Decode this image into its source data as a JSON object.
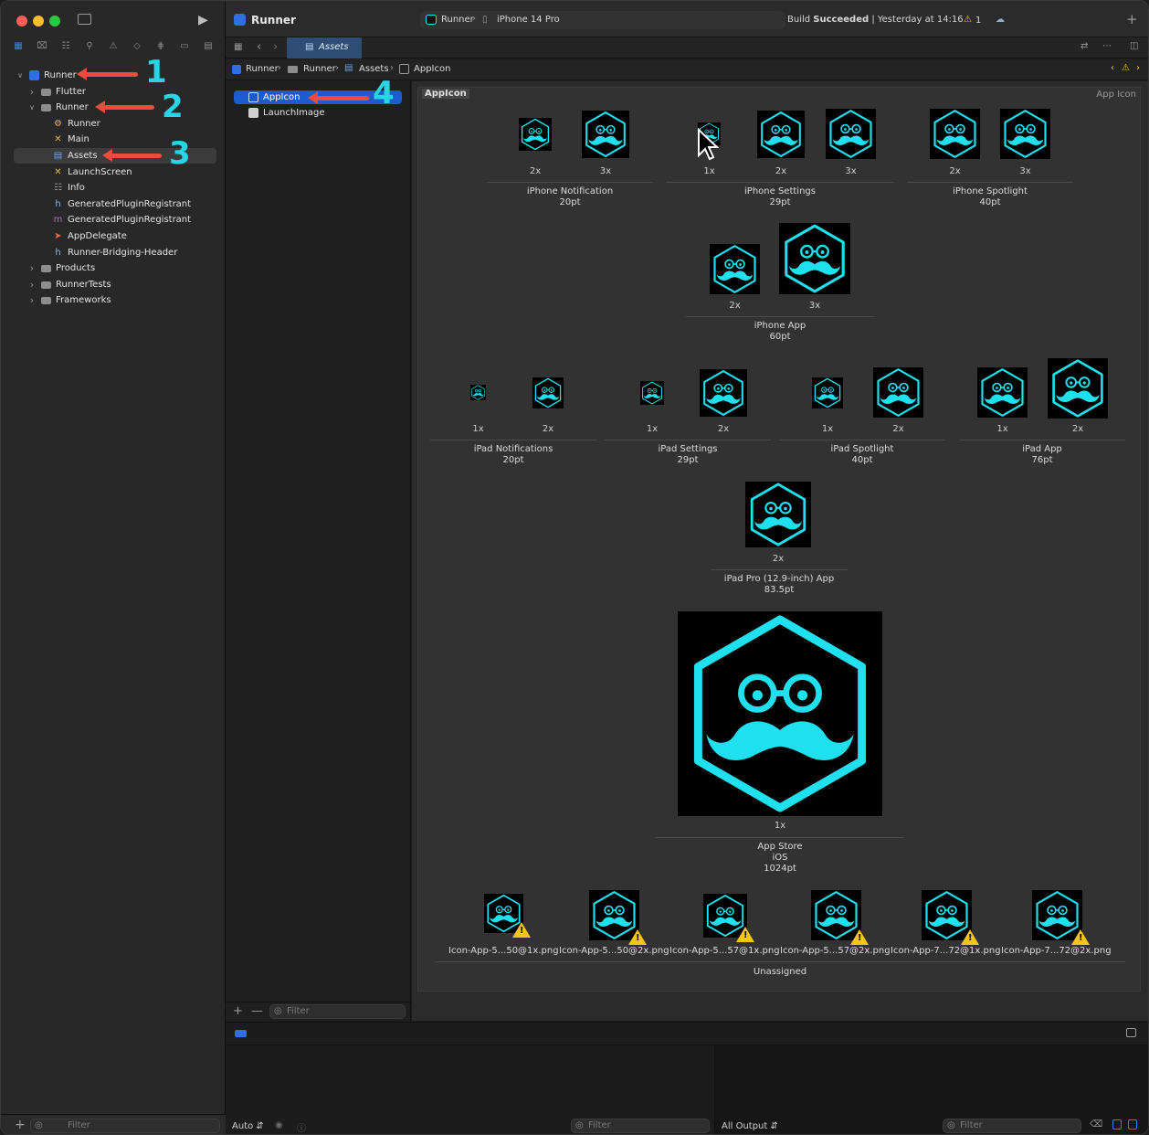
{
  "window": {
    "title": "Runner",
    "scheme": "Runner",
    "device": "iPhone 14 Pro",
    "status_prefix": "Build",
    "status_main": "Succeeded",
    "status_time": "Yesterday at 14:16",
    "warning_count": "1"
  },
  "tabs": [
    {
      "label": "Assets"
    }
  ],
  "breadcrumb": [
    "Runner",
    "Runner",
    "Assets",
    "AppIcon"
  ],
  "navigator": {
    "items": [
      {
        "label": "Runner",
        "level": 0,
        "kind": "project",
        "expanded": true
      },
      {
        "label": "Flutter",
        "level": 1,
        "kind": "folder",
        "expanded": false
      },
      {
        "label": "Runner",
        "level": 1,
        "kind": "folder",
        "expanded": true
      },
      {
        "label": "Runner",
        "level": 2,
        "kind": "entitlements"
      },
      {
        "label": "Main",
        "level": 2,
        "kind": "storyboard"
      },
      {
        "label": "Assets",
        "level": 2,
        "kind": "assets",
        "selected": true
      },
      {
        "label": "LaunchScreen",
        "level": 2,
        "kind": "storyboard"
      },
      {
        "label": "Info",
        "level": 2,
        "kind": "plist"
      },
      {
        "label": "GeneratedPluginRegistrant",
        "level": 2,
        "kind": "header"
      },
      {
        "label": "GeneratedPluginRegistrant",
        "level": 2,
        "kind": "objc"
      },
      {
        "label": "AppDelegate",
        "level": 2,
        "kind": "swift"
      },
      {
        "label": "Runner-Bridging-Header",
        "level": 2,
        "kind": "header"
      },
      {
        "label": "Products",
        "level": 1,
        "kind": "folder",
        "expanded": false
      },
      {
        "label": "RunnerTests",
        "level": 1,
        "kind": "folder",
        "expanded": false
      },
      {
        "label": "Frameworks",
        "level": 1,
        "kind": "folder",
        "expanded": false
      }
    ],
    "filter_placeholder": "Filter"
  },
  "annotations": [
    "1",
    "2",
    "3",
    "4"
  ],
  "asset_list": {
    "items": [
      {
        "label": "AppIcon",
        "selected": true
      },
      {
        "label": "LaunchImage"
      }
    ],
    "filter_placeholder": "Filter"
  },
  "editor": {
    "set_name": "AppIcon",
    "set_type": "App Icon",
    "groups": [
      {
        "name": "iPhone Notification",
        "size": "20pt",
        "slots": [
          "2x",
          "3x"
        ]
      },
      {
        "name": "iPhone Settings",
        "size": "29pt",
        "slots": [
          "1x",
          "2x",
          "3x"
        ]
      },
      {
        "name": "iPhone Spotlight",
        "size": "40pt",
        "slots": [
          "2x",
          "3x"
        ]
      },
      {
        "name": "iPhone App",
        "size": "60pt",
        "slots": [
          "2x",
          "3x"
        ]
      },
      {
        "name": "iPad Notifications",
        "size": "20pt",
        "slots": [
          "1x",
          "2x"
        ]
      },
      {
        "name": "iPad Settings",
        "size": "29pt",
        "slots": [
          "1x",
          "2x"
        ]
      },
      {
        "name": "iPad Spotlight",
        "size": "40pt",
        "slots": [
          "1x",
          "2x"
        ]
      },
      {
        "name": "iPad App",
        "size": "76pt",
        "slots": [
          "1x",
          "2x"
        ]
      },
      {
        "name": "iPad Pro (12.9-inch) App",
        "size": "83.5pt",
        "slots": [
          "2x"
        ]
      },
      {
        "name": "App Store",
        "platform": "iOS",
        "size": "1024pt",
        "slots": [
          "1x"
        ]
      }
    ],
    "unassigned": {
      "title": "Unassigned",
      "files": [
        "Icon-App-5...50@1x.png",
        "Icon-App-5...50@2x.png",
        "Icon-App-5...57@1x.png",
        "Icon-App-5...57@2x.png",
        "Icon-App-7...72@1x.png",
        "Icon-App-7...72@2x.png"
      ]
    },
    "icon_color": "#1fe0ee"
  },
  "debug": {
    "auto_label": "Auto",
    "output_label": "All Output",
    "filter_placeholder": "Filter"
  },
  "colors": {
    "accent": "#1a5bd0",
    "annotation_arrow": "#ef4b3c",
    "annotation_number": "#27d6e6",
    "warning": "#f5c518"
  }
}
